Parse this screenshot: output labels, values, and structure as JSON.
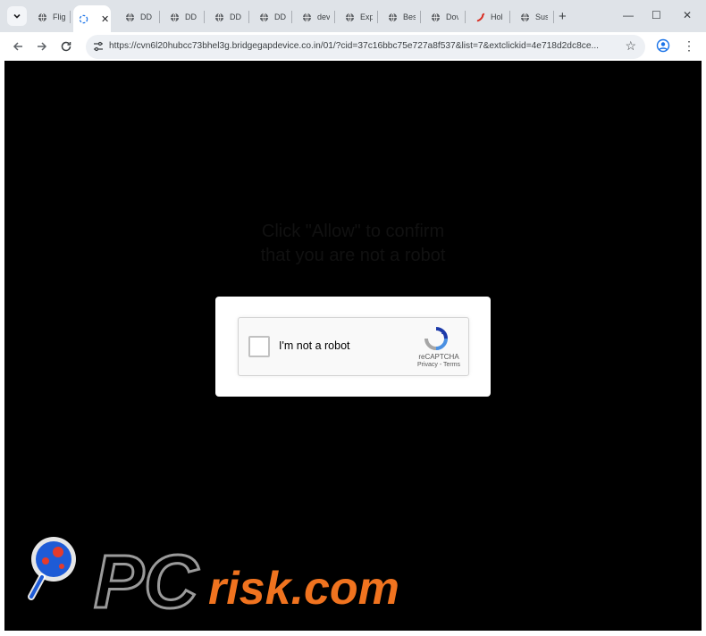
{
  "browser": {
    "tabs": [
      {
        "label": "Flig",
        "icon": "globe-icon"
      },
      {
        "label": "",
        "icon": "loading-spinner-icon",
        "active": true
      },
      {
        "label": "DD",
        "icon": "globe-icon"
      },
      {
        "label": "DD",
        "icon": "globe-icon"
      },
      {
        "label": "DD",
        "icon": "globe-icon"
      },
      {
        "label": "DD",
        "icon": "globe-icon"
      },
      {
        "label": "dev",
        "icon": "globe-icon"
      },
      {
        "label": "Exp",
        "icon": "globe-icon"
      },
      {
        "label": "Bes",
        "icon": "globe-icon"
      },
      {
        "label": "Dov",
        "icon": "globe-icon"
      },
      {
        "label": "Hol",
        "icon": "chili-icon"
      },
      {
        "label": "Sus",
        "icon": "globe-icon"
      }
    ],
    "new_tab_symbol": "+",
    "minimize_symbol": "—",
    "maximize_symbol": "☐",
    "close_symbol": "✕",
    "url": "https://cvn6l20hubcc73bhel3g.bridgegapdevice.co.in/01/?cid=37c16bbc75e727a8f537&list=7&extclickid=4e718d2dc8ce..."
  },
  "page": {
    "headline_line1": "Click \"Allow\" to confirm",
    "headline_line2": "that you are not a robot",
    "captcha": {
      "label": "I'm not a robot",
      "brand": "reCAPTCHA",
      "links": "Privacy - Terms",
      "checked": false
    },
    "watermark": {
      "text_pc": "PC",
      "text_risk": "risk.com"
    }
  },
  "colors": {
    "page_bg": "#000000",
    "chrome_bg": "#dfe3e8",
    "watermark_orange": "#f0731f",
    "watermark_gray": "#9a9a9a"
  }
}
